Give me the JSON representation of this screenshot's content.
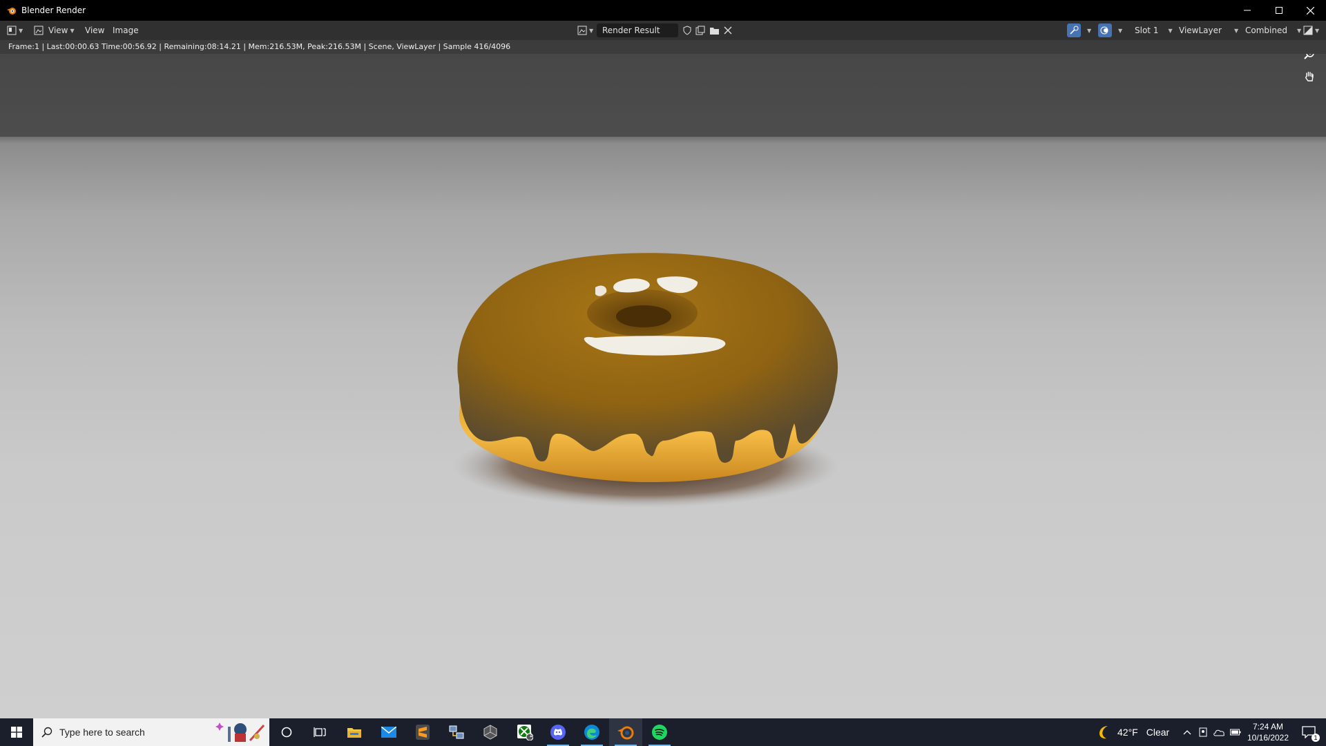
{
  "window": {
    "title": "Blender Render",
    "icon": "blender-icon",
    "controls": [
      "minimize-icon",
      "maximize-icon",
      "close-icon"
    ]
  },
  "header": {
    "view_menu_1": "View",
    "view_menu_2": "View",
    "image_menu": "Image",
    "image_name": "Render Result",
    "slot": "Slot 1",
    "view_layer": "ViewLayer",
    "pass": "Combined"
  },
  "status": {
    "text": "Frame:1 | Last:00:00.63 Time:00:56.92 | Remaining:08:14.21 | Mem:216.53M, Peak:216.53M | Scene, ViewLayer | Sample 416/4096"
  },
  "render": {
    "subject": "donut-render",
    "colors": {
      "icing": "#9a6a16",
      "dough": "#f0b23a",
      "floor": "#cccccc",
      "wall": "#4a4a4a"
    }
  },
  "taskbar": {
    "search_placeholder": "Type here to search",
    "apps": [
      "cortana-icon",
      "task-view-icon",
      "file-explorer-icon",
      "mail-icon",
      "sublime-text-icon",
      "network-app-icon",
      "unity-icon",
      "xbox-icon",
      "discord-icon",
      "edge-icon",
      "blender-icon",
      "spotify-icon"
    ],
    "xbox_badge": "1",
    "weather": {
      "temp": "42°F",
      "condition": "Clear"
    },
    "time": "7:24 AM",
    "date": "10/16/2022",
    "notification_count": "1"
  }
}
